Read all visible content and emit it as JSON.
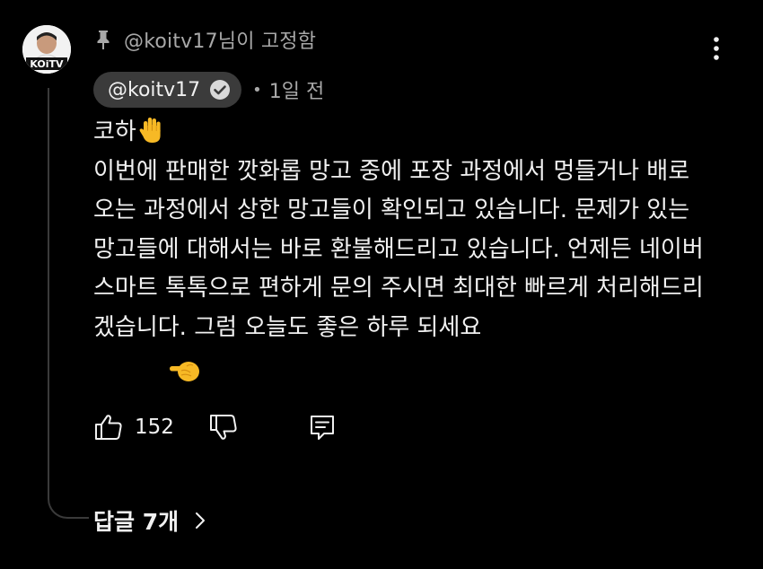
{
  "pinned": {
    "icon": "pin-icon",
    "text": "@koitv17님이 고정함"
  },
  "author": {
    "handle": "@koitv17",
    "verified_icon": "verified-check-icon",
    "avatar_text": "KOiTV",
    "separator": "•",
    "timestamp": "1일 전"
  },
  "comment": {
    "greeting": "코하",
    "greeting_emoji": "raised-hand-emoji",
    "body": "이번에 판매한 깟화롭 망고 중에 포장 과정에서 멍들거나 배로 오는 과정에서 상한 망고들이 확인되고 있습니다. 문제가 있는 망고들에 대해서는 바로 환불해드리고 있습니다. 언제든 네이버 스마트 톡톡으로 편하게 문의 주시면 최대한 빠르게 처리해드리겠습니다. 그럼 오늘도 좋은 하루 되세요",
    "closing_emoji": "pointing-hand-emoji"
  },
  "actions": {
    "like_icon": "thumbs-up-icon",
    "like_count": "152",
    "dislike_icon": "thumbs-down-icon",
    "reply_icon": "reply-comment-icon"
  },
  "replies": {
    "label": "답글 7개",
    "icon": "chevron-right-icon"
  },
  "more_icon": "more-vertical-icon",
  "colors": {
    "background": "#000000",
    "text_primary": "#f1f1f1",
    "text_secondary": "#a8a8a8",
    "chip_background": "#3b3b3b",
    "thread_line": "#3a3a3a"
  }
}
